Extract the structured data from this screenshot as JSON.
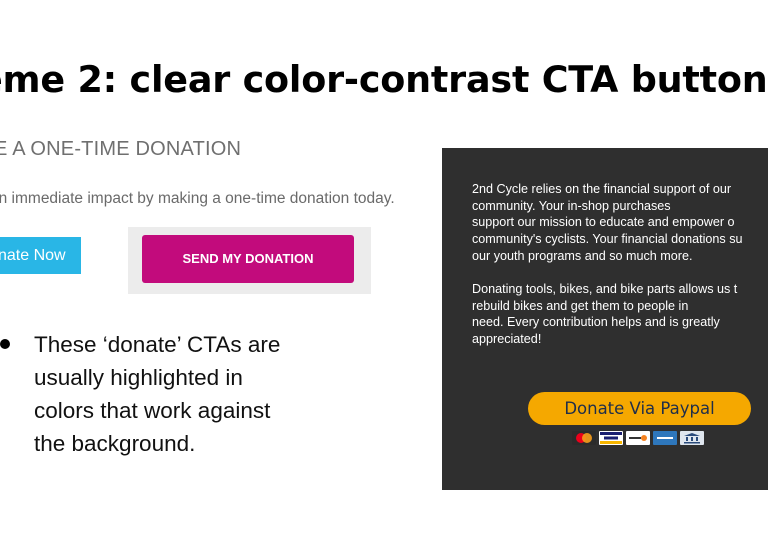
{
  "slide": {
    "title": "eme 2: clear color-contrast CTA button"
  },
  "donation_section": {
    "heading": "E A ONE-TIME DONATION",
    "subtext": "an immediate impact by making a one-time donation today.",
    "donate_now_label": "nate Now",
    "send_donation_label": "SEND MY DONATION",
    "donate_now_color": "#29b6e6",
    "send_donation_color": "#c20b7c"
  },
  "bullet": {
    "lines": [
      "These ‘donate’ CTAs are",
      "usually highlighted in",
      "colors that work against",
      "the background."
    ]
  },
  "paypal_panel": {
    "paragraph1_lines": [
      "2nd Cycle relies on the financial support of our",
      "community. Your in-shop purchases",
      "support our mission to educate and empower o",
      "community's cyclists. Your financial donations su",
      "our youth programs and so much more."
    ],
    "paragraph2_lines": [
      "Donating tools, bikes, and bike parts allows us t",
      "rebuild bikes and get them to people in",
      "need. Every contribution helps and is greatly",
      "appreciated!"
    ],
    "paypal_button_label": "Donate Via Paypal",
    "paypal_button_color": "#f5a800",
    "payment_icons": [
      "mastercard-icon",
      "visa-icon",
      "discover-icon",
      "amex-icon",
      "bank-icon"
    ]
  }
}
